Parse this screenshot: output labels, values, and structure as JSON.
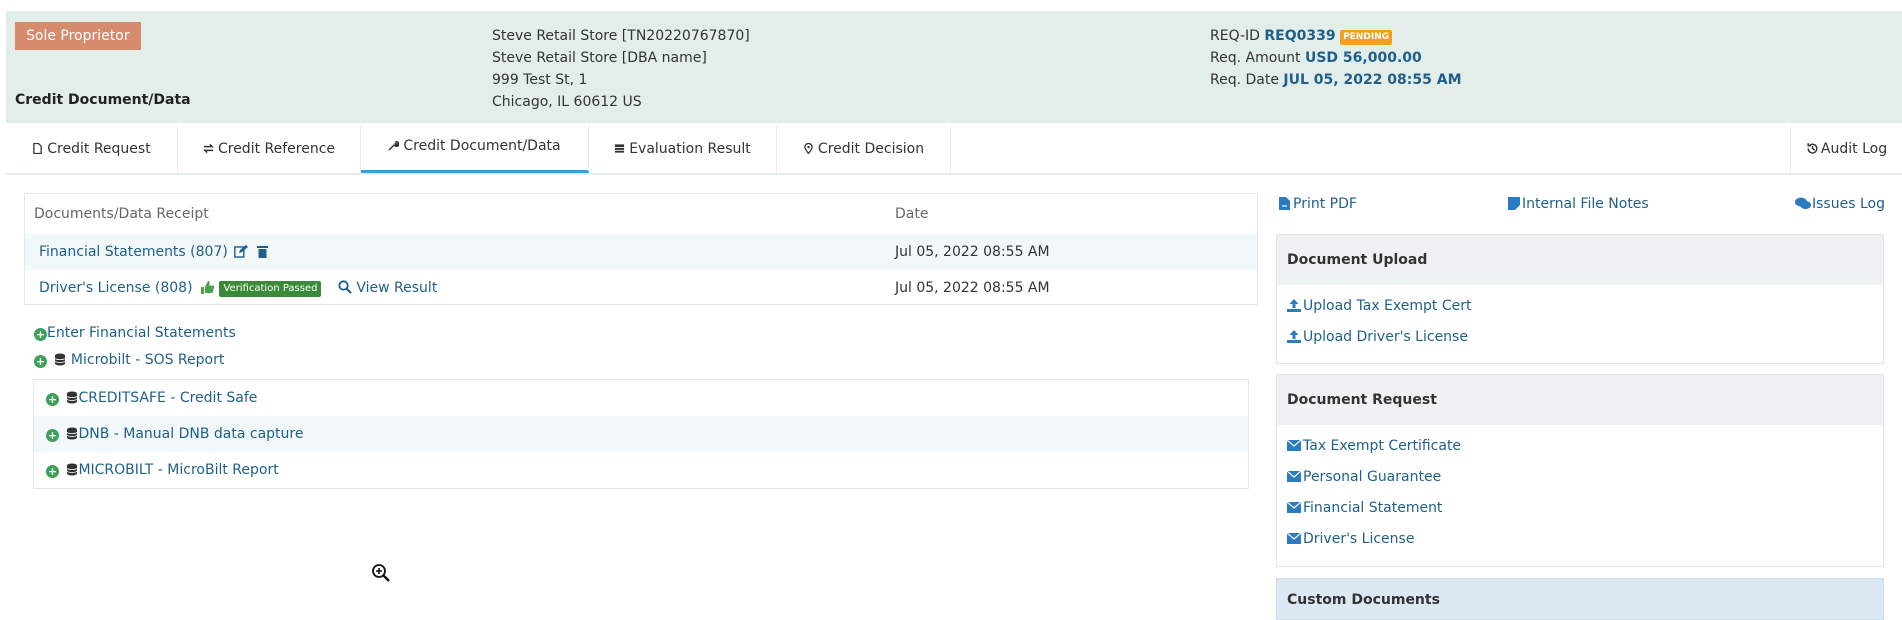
{
  "header": {
    "entity_type": "Sole Proprietor",
    "section_title": "Credit Document/Data",
    "address_lines": [
      "Steve Retail Store [TN20220767870]",
      "Steve Retail Store [DBA name]",
      "999 Test St, 1",
      "Chicago, IL 60612 US"
    ],
    "req_id_label": "REQ-ID",
    "req_id": "REQ0339",
    "status": "PENDING",
    "req_amount_label": "Req. Amount",
    "req_amount": "USD 56,000.00",
    "req_date_label": "Req. Date",
    "req_date": "JUL 05, 2022 08:55 AM"
  },
  "tabs": [
    {
      "label": "Credit Request",
      "icon": "file-icon"
    },
    {
      "label": "Credit Reference",
      "icon": "exchange-icon"
    },
    {
      "label": "Credit Document/Data",
      "icon": "wrench-icon"
    },
    {
      "label": "Evaluation Result",
      "icon": "table-icon"
    },
    {
      "label": "Credit Decision",
      "icon": "map-marker-icon"
    }
  ],
  "audit_log_label": "Audit Log",
  "documents": {
    "col_doc": "Documents/Data Receipt",
    "col_date": "Date",
    "rows": [
      {
        "name": "Financial Statements (807)",
        "date": "Jul 05, 2022 08:55 AM"
      },
      {
        "name": "Driver's License (808)",
        "badge": "Verification Passed",
        "view": "View Result",
        "date": "Jul 05, 2022 08:55 AM"
      }
    ]
  },
  "actions": {
    "enter_financial": "Enter Financial Statements",
    "microbilt_sos": "Microbilt - SOS Report"
  },
  "external_sources": [
    "CREDITSAFE - Credit Safe",
    "DNB - Manual DNB data capture",
    "MICROBILT - MicroBilt Report"
  ],
  "right_links": {
    "print_pdf": "Print PDF",
    "internal_notes": "Internal File Notes",
    "issues_log": "Issues Log"
  },
  "document_upload": {
    "title": "Document Upload",
    "items": [
      "Upload Tax Exempt Cert",
      "Upload Driver's License"
    ]
  },
  "document_request": {
    "title": "Document Request",
    "items": [
      "Tax Exempt Certificate",
      "Personal Guarantee",
      "Financial Statement",
      "Driver's License"
    ]
  },
  "custom_documents": {
    "title": "Custom Documents"
  },
  "colors": {
    "header_bg": "#e3eeea",
    "accent": "#3a9fd6",
    "link": "#1f5f8b",
    "badge_type": "#d68b6c",
    "pending": "#f0a020",
    "verified": "#3a8a3a",
    "plus": "#3ca25a"
  }
}
